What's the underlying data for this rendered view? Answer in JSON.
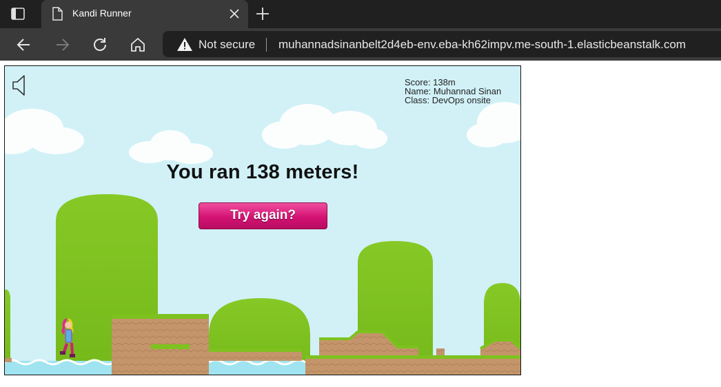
{
  "browser": {
    "tab_title": "Kandi Runner",
    "security_label": "Not secure",
    "url": "muhannadsinanbelt2d4eb-env.eba-kh62impv.me-south-1.elasticbeanstalk.com"
  },
  "game": {
    "hud": {
      "score": "Score: 138m",
      "name": "Name: Muhannad Sinan",
      "class": "Class: DevOps onsite"
    },
    "message": "You ran 138 meters!",
    "retry_label": "Try again?",
    "sound_icon": "speaker-icon"
  },
  "colors": {
    "sky": "#d1f1f7",
    "grass": "#7dc21e",
    "dirt": "#c4956a",
    "water": "#9fe4f0",
    "button": "#d41273"
  }
}
